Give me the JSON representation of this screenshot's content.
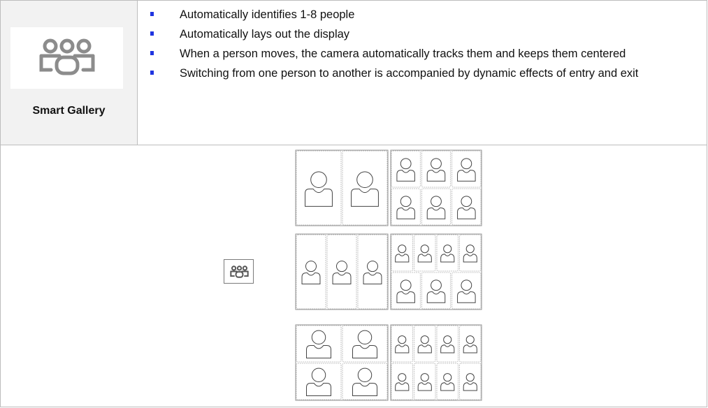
{
  "feature": {
    "icon": "smart-gallery-icon",
    "title": "Smart Gallery",
    "bullets": [
      "Automatically identifies 1-8 people",
      "Automatically lays out the display",
      "When a person moves, the camera automatically tracks them and keeps them centered",
      "Switching from one person to another is accompanied by dynamic effects of entry and exit"
    ]
  },
  "layouts": [
    {
      "name": "2-person and 6-person layouts",
      "left": {
        "cols": 2,
        "rows": 1
      },
      "right": {
        "cols": 3,
        "rows": 2
      }
    },
    {
      "name": "3-person and 7-person layouts",
      "left": {
        "cols": 3,
        "rows": 1
      },
      "right": {
        "cols": 4,
        "rows": 2,
        "bottom_cols": 3
      }
    },
    {
      "name": "4-person and 8-person layouts",
      "left": {
        "cols": 2,
        "rows": 2
      },
      "right": {
        "cols": 4,
        "rows": 2
      }
    }
  ],
  "colors": {
    "bullet": "#1f34e0",
    "header_bg": "#f2f2f2",
    "border": "#bdbdbd"
  }
}
